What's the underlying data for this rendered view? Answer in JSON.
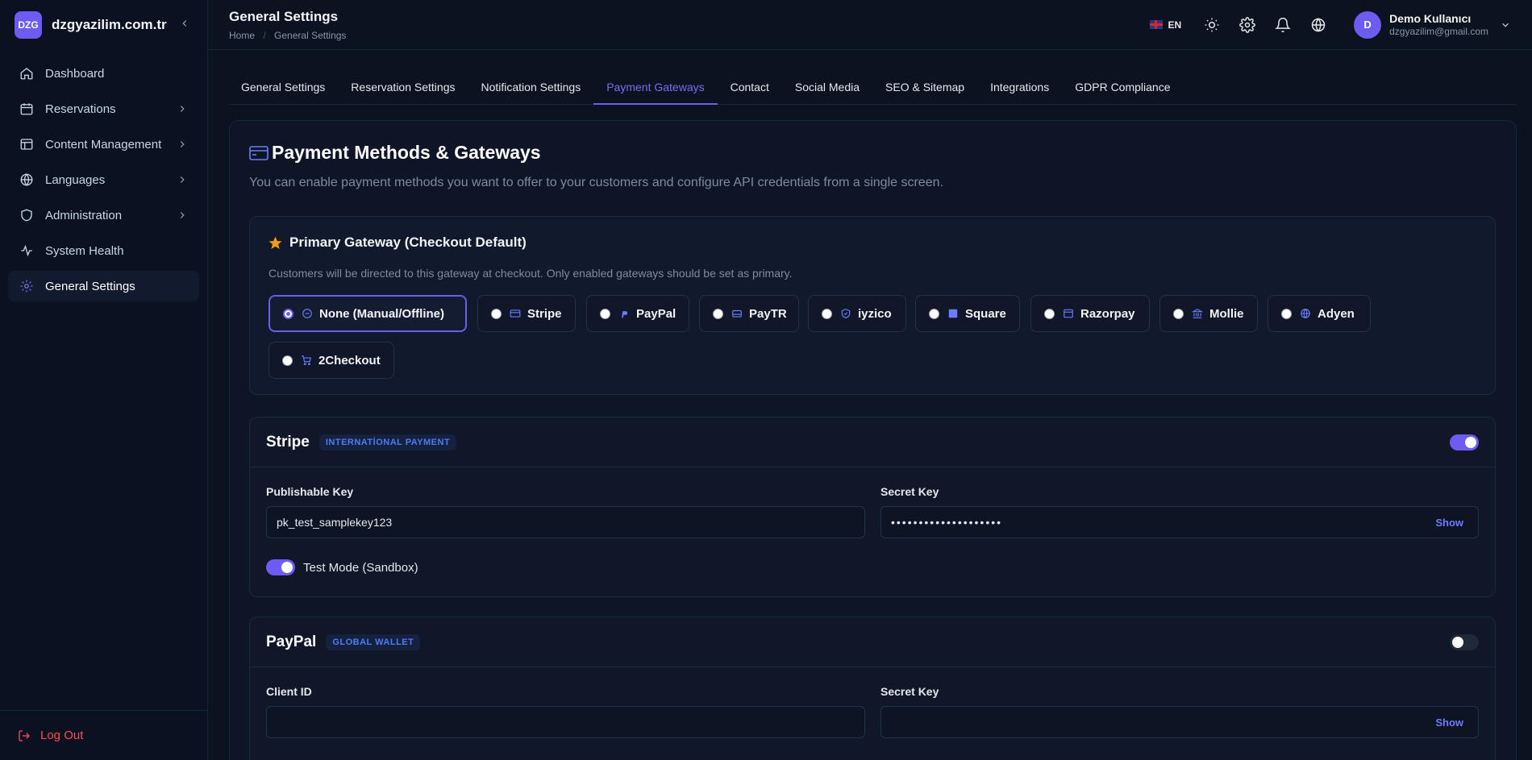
{
  "brand": {
    "logo_text": "DZG",
    "name": "dzgyazilim.com.tr"
  },
  "sidebar": {
    "items": [
      {
        "label": "Dashboard",
        "icon": "home-icon"
      },
      {
        "label": "Reservations",
        "icon": "calendar-icon"
      },
      {
        "label": "Content Management",
        "icon": "layout-icon"
      },
      {
        "label": "Languages",
        "icon": "globe-icon"
      },
      {
        "label": "Administration",
        "icon": "shield-icon"
      },
      {
        "label": "System Health",
        "icon": "activity-icon"
      },
      {
        "label": "General Settings",
        "icon": "gear-icon"
      }
    ],
    "logout_label": "Log Out"
  },
  "header": {
    "title": "General Settings",
    "breadcrumb": [
      "Home",
      "General Settings"
    ],
    "language": "EN",
    "user": {
      "initial": "D",
      "name": "Demo Kullanıcı",
      "email": "dzgyazilim@gmail.com"
    }
  },
  "tabs": [
    "General Settings",
    "Reservation Settings",
    "Notification Settings",
    "Payment Gateways",
    "Contact",
    "Social Media",
    "SEO & Sitemap",
    "Integrations",
    "GDPR Compliance"
  ],
  "active_tab": "Payment Gateways",
  "payment": {
    "title": "Payment Methods & Gateways",
    "description": "You can enable payment methods you want to offer to your customers and configure API credentials from a single screen.",
    "primary": {
      "title": "Primary Gateway (Checkout Default)",
      "description": "Customers will be directed to this gateway at checkout. Only enabled gateways should be set as primary.",
      "options": [
        {
          "label": "None (Manual/Offline)",
          "icon": "minus-circle-icon",
          "selected": true
        },
        {
          "label": "Stripe",
          "icon": "credit-card-icon"
        },
        {
          "label": "PayPal",
          "icon": "paypal-icon"
        },
        {
          "label": "PayTR",
          "icon": "wallet-icon"
        },
        {
          "label": "iyzico",
          "icon": "shield-check-icon"
        },
        {
          "label": "Square",
          "icon": "square-icon"
        },
        {
          "label": "Razorpay",
          "icon": "window-icon"
        },
        {
          "label": "Mollie",
          "icon": "bank-icon"
        },
        {
          "label": "Adyen",
          "icon": "globe-icon"
        },
        {
          "label": "2Checkout",
          "icon": "cart-icon"
        }
      ]
    },
    "stripe": {
      "name": "Stripe",
      "badge": "INTERNATİONAL PAYMENT",
      "enabled": true,
      "publishable_label": "Publishable Key",
      "publishable_value": "pk_test_samplekey123",
      "secret_label": "Secret Key",
      "secret_value": "••••••••••••••••••••",
      "show_label": "Show",
      "sandbox_label": "Test Mode (Sandbox)",
      "sandbox_enabled": true
    },
    "paypal": {
      "name": "PayPal",
      "badge": "GLOBAL WALLET",
      "enabled": false,
      "client_label": "Client ID",
      "client_value": "",
      "secret_label": "Secret Key",
      "secret_value": "",
      "show_label": "Show"
    }
  },
  "colors": {
    "accent": "#6d5bf2",
    "background": "#0b1220",
    "danger": "#ff4b55",
    "star": "#f59e0b"
  }
}
